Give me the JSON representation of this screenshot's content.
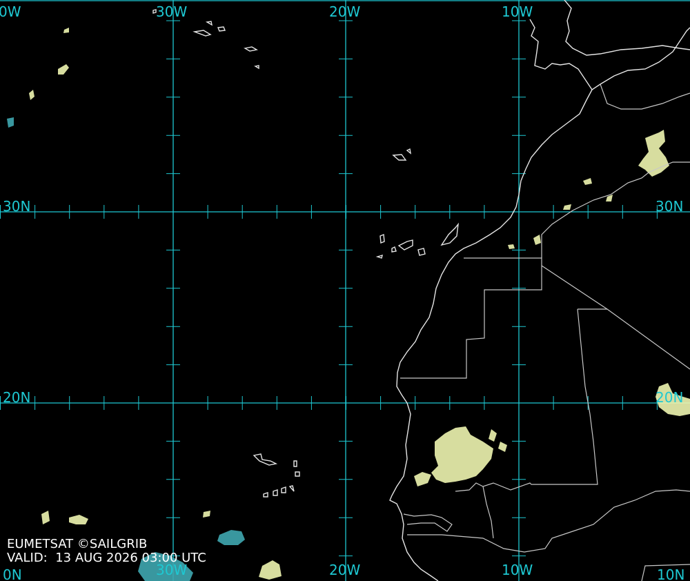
{
  "map": {
    "grid_labels": {
      "lon_top": [
        "0W",
        "30W",
        "20W",
        "10W"
      ],
      "lat_right": [
        "30N",
        "20N"
      ],
      "lat_left": [
        "30N",
        "20N"
      ],
      "lon_bottom": [
        "20W",
        "10W"
      ],
      "bottom_right": "10N",
      "bottom_left_partial": "0N",
      "bottom_30w": "30W"
    },
    "colors": {
      "grid": "#1ec8d2",
      "coastline": "#e6e6e6",
      "cloud_light": "#eef5b0",
      "cloud_cold": "#3fa7b0",
      "background": "#000000"
    }
  },
  "credit": {
    "source": "EUMETSAT ©SAILGRIB",
    "valid_prefix": "VALID:",
    "valid_time": "13 AUG 2026 03:00 UTC"
  }
}
